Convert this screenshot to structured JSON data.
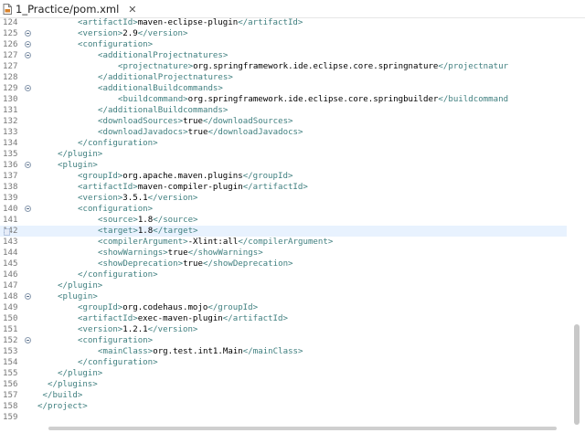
{
  "tab": {
    "title": "1_Practice/pom.xml",
    "close_symbol": "✕",
    "icon": "xml-file-icon"
  },
  "colors": {
    "tag": "#3f7f7f",
    "bracket": "#008080",
    "text": "#000000",
    "line_number": "#777777",
    "current_line": "#e8f2fe"
  },
  "current_line_number": "142",
  "lines": [
    {
      "n": "124",
      "indent": 8,
      "fold": false,
      "parts": [
        [
          "t",
          "<artifactId>"
        ],
        [
          "v",
          "maven-eclipse-plugin"
        ],
        [
          "t",
          "</artifactId>"
        ]
      ]
    },
    {
      "n": "125",
      "indent": 8,
      "fold": true,
      "parts": [
        [
          "t",
          "<version>"
        ],
        [
          "v",
          "2.9"
        ],
        [
          "t",
          "</version>"
        ]
      ]
    },
    {
      "n": "126",
      "indent": 8,
      "fold": true,
      "parts": [
        [
          "t",
          "<configuration>"
        ]
      ]
    },
    {
      "n": "127",
      "indent": 12,
      "fold": true,
      "parts": [
        [
          "t",
          "<additionalProjectnatures>"
        ]
      ]
    },
    {
      "n": "127",
      "indent": 16,
      "fold": false,
      "parts": [
        [
          "t",
          "<projectnature>"
        ],
        [
          "v",
          "org.springframework.ide.eclipse.core.springnature"
        ],
        [
          "t",
          "</projectnatur"
        ]
      ]
    },
    {
      "n": "128",
      "indent": 12,
      "fold": false,
      "parts": [
        [
          "t",
          "</additionalProjectnatures>"
        ]
      ]
    },
    {
      "n": "129",
      "indent": 12,
      "fold": true,
      "parts": [
        [
          "t",
          "<additionalBuildcommands>"
        ]
      ]
    },
    {
      "n": "130",
      "indent": 16,
      "fold": false,
      "parts": [
        [
          "t",
          "<buildcommand>"
        ],
        [
          "v",
          "org.springframework.ide.eclipse.core.springbuilder"
        ],
        [
          "t",
          "</buildcommand"
        ]
      ]
    },
    {
      "n": "131",
      "indent": 12,
      "fold": false,
      "parts": [
        [
          "t",
          "</additionalBuildcommands>"
        ]
      ]
    },
    {
      "n": "132",
      "indent": 12,
      "fold": false,
      "parts": [
        [
          "t",
          "<downloadSources>"
        ],
        [
          "v",
          "true"
        ],
        [
          "t",
          "</downloadSources>"
        ]
      ]
    },
    {
      "n": "133",
      "indent": 12,
      "fold": false,
      "parts": [
        [
          "t",
          "<downloadJavadocs>"
        ],
        [
          "v",
          "true"
        ],
        [
          "t",
          "</downloadJavadocs>"
        ]
      ]
    },
    {
      "n": "134",
      "indent": 8,
      "fold": false,
      "parts": [
        [
          "t",
          "</configuration>"
        ]
      ]
    },
    {
      "n": "135",
      "indent": 4,
      "fold": false,
      "parts": [
        [
          "t",
          "</plugin>"
        ]
      ]
    },
    {
      "n": "136",
      "indent": 4,
      "fold": true,
      "parts": [
        [
          "t",
          "<plugin>"
        ]
      ]
    },
    {
      "n": "137",
      "indent": 8,
      "fold": false,
      "parts": [
        [
          "t",
          "<groupId>"
        ],
        [
          "v",
          "org.apache.maven.plugins"
        ],
        [
          "t",
          "</groupId>"
        ]
      ]
    },
    {
      "n": "138",
      "indent": 8,
      "fold": false,
      "parts": [
        [
          "t",
          "<artifactId>"
        ],
        [
          "v",
          "maven-compiler-plugin"
        ],
        [
          "t",
          "</artifactId>"
        ]
      ]
    },
    {
      "n": "139",
      "indent": 8,
      "fold": false,
      "parts": [
        [
          "t",
          "<version>"
        ],
        [
          "v",
          "3.5.1"
        ],
        [
          "t",
          "</version>"
        ]
      ]
    },
    {
      "n": "140",
      "indent": 8,
      "fold": true,
      "parts": [
        [
          "t",
          "<configuration>"
        ]
      ]
    },
    {
      "n": "141",
      "indent": 12,
      "fold": false,
      "parts": [
        [
          "t",
          "<source>"
        ],
        [
          "v",
          "1.8"
        ],
        [
          "t",
          "</source>"
        ]
      ]
    },
    {
      "n": "142",
      "indent": 12,
      "fold": false,
      "parts": [
        [
          "t",
          "<target>"
        ],
        [
          "v",
          "1.8"
        ],
        [
          "t",
          "</target>"
        ]
      ]
    },
    {
      "n": "143",
      "indent": 12,
      "fold": false,
      "parts": [
        [
          "t",
          "<compilerArgument>"
        ],
        [
          "v",
          "-Xlint:all"
        ],
        [
          "t",
          "</compilerArgument>"
        ]
      ]
    },
    {
      "n": "144",
      "indent": 12,
      "fold": false,
      "parts": [
        [
          "t",
          "<showWarnings>"
        ],
        [
          "v",
          "true"
        ],
        [
          "t",
          "</showWarnings>"
        ]
      ]
    },
    {
      "n": "145",
      "indent": 12,
      "fold": false,
      "parts": [
        [
          "t",
          "<showDeprecation>"
        ],
        [
          "v",
          "true"
        ],
        [
          "t",
          "</showDeprecation>"
        ]
      ]
    },
    {
      "n": "146",
      "indent": 8,
      "fold": false,
      "parts": [
        [
          "t",
          "</configuration>"
        ]
      ]
    },
    {
      "n": "147",
      "indent": 4,
      "fold": false,
      "parts": [
        [
          "t",
          "</plugin>"
        ]
      ]
    },
    {
      "n": "148",
      "indent": 4,
      "fold": true,
      "parts": [
        [
          "t",
          "<plugin>"
        ]
      ]
    },
    {
      "n": "149",
      "indent": 8,
      "fold": false,
      "parts": [
        [
          "t",
          "<groupId>"
        ],
        [
          "v",
          "org.codehaus.mojo"
        ],
        [
          "t",
          "</groupId>"
        ]
      ]
    },
    {
      "n": "150",
      "indent": 8,
      "fold": false,
      "parts": [
        [
          "t",
          "<artifactId>"
        ],
        [
          "v",
          "exec-maven-plugin"
        ],
        [
          "t",
          "</artifactId>"
        ]
      ]
    },
    {
      "n": "151",
      "indent": 8,
      "fold": false,
      "parts": [
        [
          "t",
          "<version>"
        ],
        [
          "v",
          "1.2.1"
        ],
        [
          "t",
          "</version>"
        ]
      ]
    },
    {
      "n": "152",
      "indent": 8,
      "fold": true,
      "parts": [
        [
          "t",
          "<configuration>"
        ]
      ]
    },
    {
      "n": "153",
      "indent": 12,
      "fold": false,
      "parts": [
        [
          "t",
          "<mainClass>"
        ],
        [
          "v",
          "org.test.int1.Main"
        ],
        [
          "t",
          "</mainClass>"
        ]
      ]
    },
    {
      "n": "154",
      "indent": 8,
      "fold": false,
      "parts": [
        [
          "t",
          "</configuration>"
        ]
      ]
    },
    {
      "n": "155",
      "indent": 4,
      "fold": false,
      "parts": [
        [
          "t",
          "</plugin>"
        ]
      ]
    },
    {
      "n": "156",
      "indent": 2,
      "fold": false,
      "parts": [
        [
          "t",
          "</plugins>"
        ]
      ]
    },
    {
      "n": "157",
      "indent": 1,
      "fold": false,
      "parts": [
        [
          "t",
          "</build>"
        ]
      ]
    },
    {
      "n": "158",
      "indent": 0,
      "fold": false,
      "parts": [
        [
          "t",
          "</project>"
        ]
      ]
    },
    {
      "n": "159",
      "indent": 0,
      "fold": false,
      "parts": []
    }
  ]
}
